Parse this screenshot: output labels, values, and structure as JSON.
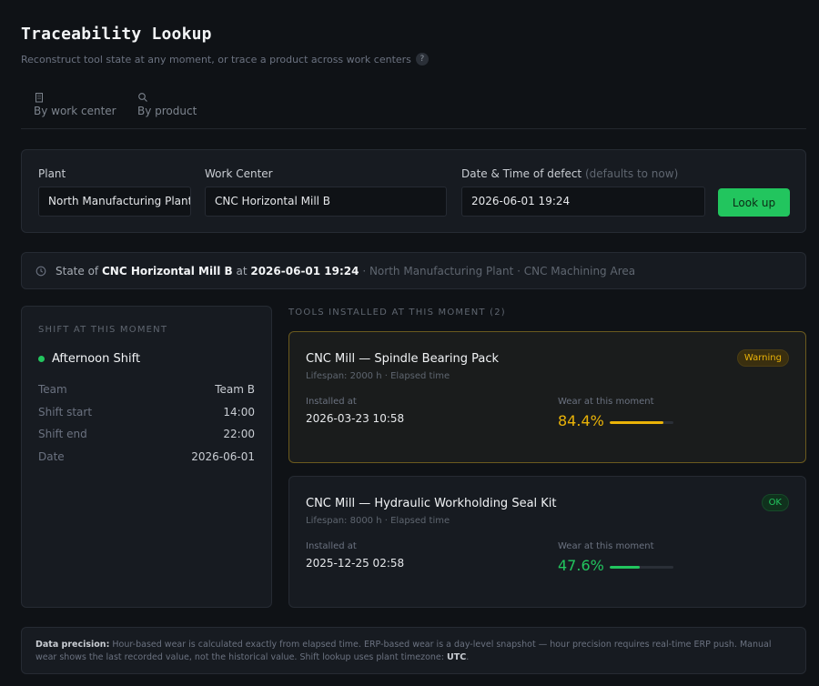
{
  "header": {
    "title": "Traceability Lookup",
    "subtitle": "Reconstruct tool state at any moment, or trace a product across work centers",
    "help_glyph": "?"
  },
  "tabs": [
    {
      "label": "By work center",
      "icon": "building-icon"
    },
    {
      "label": "By product",
      "icon": "search-icon"
    }
  ],
  "form": {
    "plant_label": "Plant",
    "plant_value": "North Manufacturing Plant",
    "work_center_label": "Work Center",
    "work_center_value": "CNC Horizontal Mill B",
    "datetime_label": "Date & Time of defect",
    "datetime_hint": "(defaults to now)",
    "datetime_value": "2026-06-01 19:24",
    "lookup_label": "Look up"
  },
  "state": {
    "prefix": "State of",
    "work_center": "CNC Horizontal Mill B",
    "at": "at",
    "datetime": "2026-06-01 19:24",
    "location": "· North Manufacturing Plant · CNC Machining Area"
  },
  "shift": {
    "section_label": "Shift at this moment",
    "name": "Afternoon Shift",
    "rows": [
      {
        "key": "Team",
        "value": "Team B"
      },
      {
        "key": "Shift start",
        "value": "14:00"
      },
      {
        "key": "Shift end",
        "value": "22:00"
      },
      {
        "key": "Date",
        "value": "2026-06-01"
      }
    ]
  },
  "tools": {
    "section_label": "Tools installed at this moment (2)",
    "items": [
      {
        "name": "CNC Mill — Spindle Bearing Pack",
        "lifespan": "Lifespan: 2000 h · Elapsed time",
        "badge": "Warning",
        "installed_label": "Installed at",
        "installed_value": "2026-03-23 10:58",
        "wear_label": "Wear at this moment",
        "wear_value": "84.4%",
        "wear_fraction": 0.844,
        "color": "#eab308"
      },
      {
        "name": "CNC Mill — Hydraulic Workholding Seal Kit",
        "lifespan": "Lifespan: 8000 h · Elapsed time",
        "badge": "OK",
        "installed_label": "Installed at",
        "installed_value": "2025-12-25 02:58",
        "wear_label": "Wear at this moment",
        "wear_value": "47.6%",
        "wear_fraction": 0.476,
        "color": "#22c55e"
      }
    ]
  },
  "precision": {
    "label": "Data precision:",
    "text": "Hour-based wear is calculated exactly from elapsed time. ERP-based wear is a day-level snapshot — hour precision requires real-time ERP push. Manual wear shows the last recorded value, not the historical value. Shift lookup uses plant timezone:",
    "timezone": "UTC",
    "end": "."
  }
}
